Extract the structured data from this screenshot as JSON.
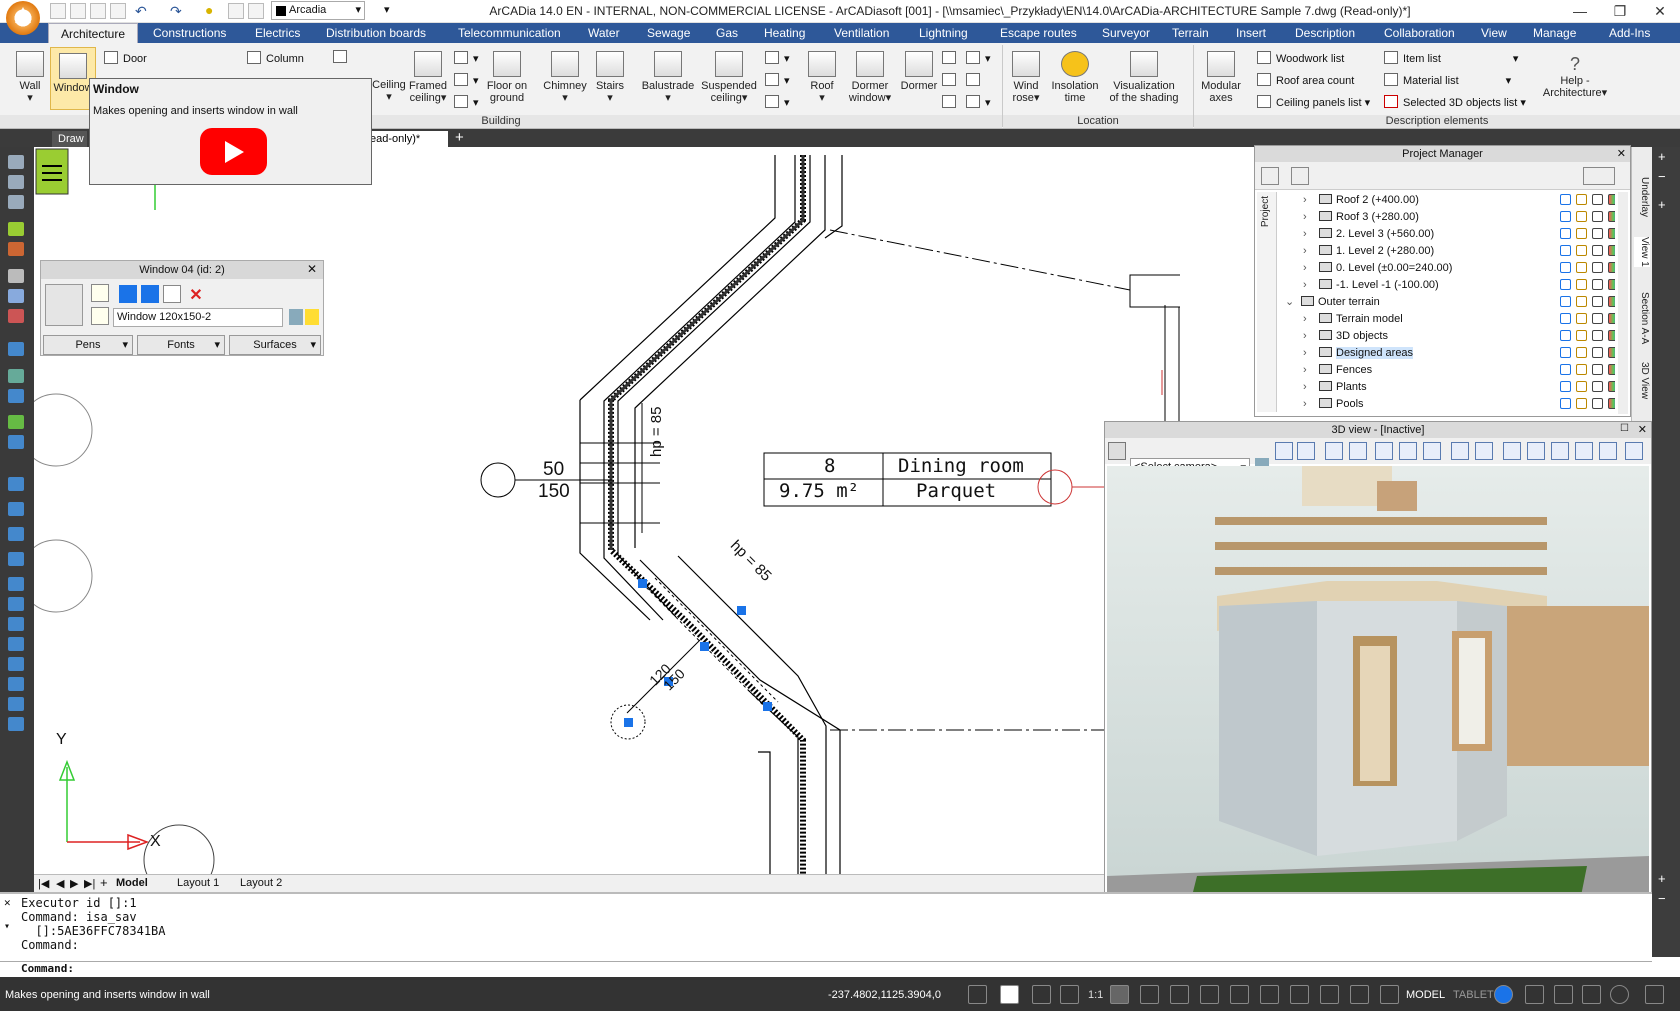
{
  "window": {
    "title": "ArCADia 14.0 EN - INTERNAL, NON-COMMERCIAL LICENSE - ArCADiasoft [001] - [\\\\msamiec\\_Przykłady\\EN\\14.0\\ArCADia-ARCHITECTURE Sample 7.dwg (Read-only)*]",
    "font_value": "Arcadia"
  },
  "tabs": [
    "Architecture",
    "Constructions",
    "Electrics",
    "Distribution boards",
    "Telecommunication",
    "Water",
    "Sewage",
    "Gas",
    "Heating",
    "Ventilation",
    "Lightning",
    "Escape routes",
    "Surveyor",
    "Terrain",
    "Insert",
    "Description",
    "Collaboration",
    "View",
    "Manage",
    "Add-Ins"
  ],
  "ribbon": {
    "wall": "Wall",
    "window": "Window",
    "door": "Door",
    "column": "Column",
    "ceiling": "Ceiling",
    "framed": "Framed",
    "framed2": "ceiling",
    "floor": "Floor on",
    "floor2": "ground",
    "chimney": "Chimney",
    "stairs": "Stairs",
    "balustrade": "Balustrade",
    "suspended": "Suspended",
    "suspended2": "ceiling",
    "roof": "Roof",
    "dormer": "Dormer",
    "dormer2": "window",
    "dormer3": "Dormer",
    "windrose": "Wind",
    "windrose2": "rose",
    "insolation": "Insolation",
    "insolation2": "time",
    "visual": "Visualization",
    "visual2": "of the shading",
    "modular": "Modular",
    "modular2": "axes",
    "woodwork": "Woodwork list",
    "roofarea": "Roof area count",
    "ceilingpanels": "Ceiling panels list",
    "itemlist": "Item list",
    "materiallist": "Material list",
    "selected3d": "Selected 3D objects list",
    "help": "Help -",
    "help2": "Architecture",
    "grp_building": "Building",
    "grp_location": "Location",
    "grp_description": "Description elements"
  },
  "doc": {
    "tab1": "Draw",
    "tab2": "ead-only)*"
  },
  "tooltip": {
    "title": "Window",
    "desc": "Makes opening and inserts window in wall"
  },
  "wprops": {
    "title": "Window 04 (id: 2)",
    "type": "Window 120x150-2",
    "pens": "Pens",
    "fonts": "Fonts",
    "surfaces": "Surfaces"
  },
  "drawing": {
    "room_no": "8",
    "room_name": "Dining room",
    "area": "9.75 m²",
    "floor": "Parquet",
    "dim_a": "50",
    "dim_b": "150",
    "hp": "hp = 85",
    "hp2": "hp = 85",
    "dim_c": "120",
    "dim_d": "150",
    "axis_y": "Y",
    "axis_x": "X"
  },
  "pm": {
    "title": "Project Manager",
    "side": "Project",
    "items": [
      {
        "label": "Roof 2 (+400.00)",
        "lvl": 1
      },
      {
        "label": "Roof 3 (+280.00)",
        "lvl": 1
      },
      {
        "label": "2. Level 3 (+560.00)",
        "lvl": 1
      },
      {
        "label": "1. Level 2 (+280.00)",
        "lvl": 1
      },
      {
        "label": "0. Level  (±0.00=240.00)",
        "lvl": 1
      },
      {
        "label": "-1. Level -1 (-100.00)",
        "lvl": 1
      },
      {
        "label": "Outer terrain",
        "lvl": 0
      },
      {
        "label": "Terrain model",
        "lvl": 1
      },
      {
        "label": "3D objects",
        "lvl": 1
      },
      {
        "label": "Designed areas",
        "lvl": 1,
        "sel": true
      },
      {
        "label": "Fences",
        "lvl": 1
      },
      {
        "label": "Plants",
        "lvl": 1
      },
      {
        "label": "Pools",
        "lvl": 1
      }
    ]
  },
  "vtabs": [
    "Underlay",
    "View 1",
    "Section A-A",
    "3D View"
  ],
  "v3d": {
    "title": "3D view - [Inactive]",
    "camera": "<Select camera>"
  },
  "layouts": [
    "Model",
    "Layout 1",
    "Layout 2"
  ],
  "cmd": [
    "Executor id []:1",
    "Command: isa_sav",
    "  []:5AE36FFC78341BA",
    "Command:"
  ],
  "cmd_input": "Command:",
  "status": {
    "msg": "Makes opening and inserts window in wall",
    "coords": "-237.4802,1125.3904,0",
    "scale": "1:1",
    "model": "MODEL",
    "tablet": "TABLET"
  }
}
